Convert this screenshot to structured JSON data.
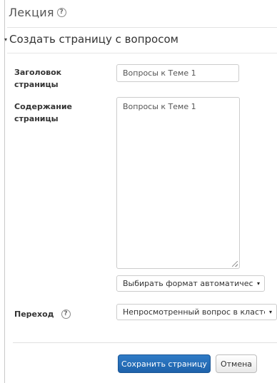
{
  "header": {
    "title": "Лекция",
    "help_glyph": "?"
  },
  "section": {
    "title": "Создать страницу с вопросом",
    "collapse_glyph": "▾"
  },
  "form": {
    "page_title_label": "Заголовок страницы",
    "page_title_value": "Вопросы к Теме 1",
    "content_label": "Содержание страницы",
    "content_value": "Вопросы к Теме 1",
    "format_selected": "Выбирать формат автоматически",
    "jump_label": "Переход",
    "jump_help_glyph": "?",
    "jump_selected": "Непросмотренный вопрос в кластере",
    "caret_glyph": "▾"
  },
  "buttons": {
    "save_label": "Сохранить страницу",
    "cancel_label": "Отмена"
  },
  "colors": {
    "primary": "#1e63ab",
    "border": "#cccccc",
    "text": "#333333"
  }
}
